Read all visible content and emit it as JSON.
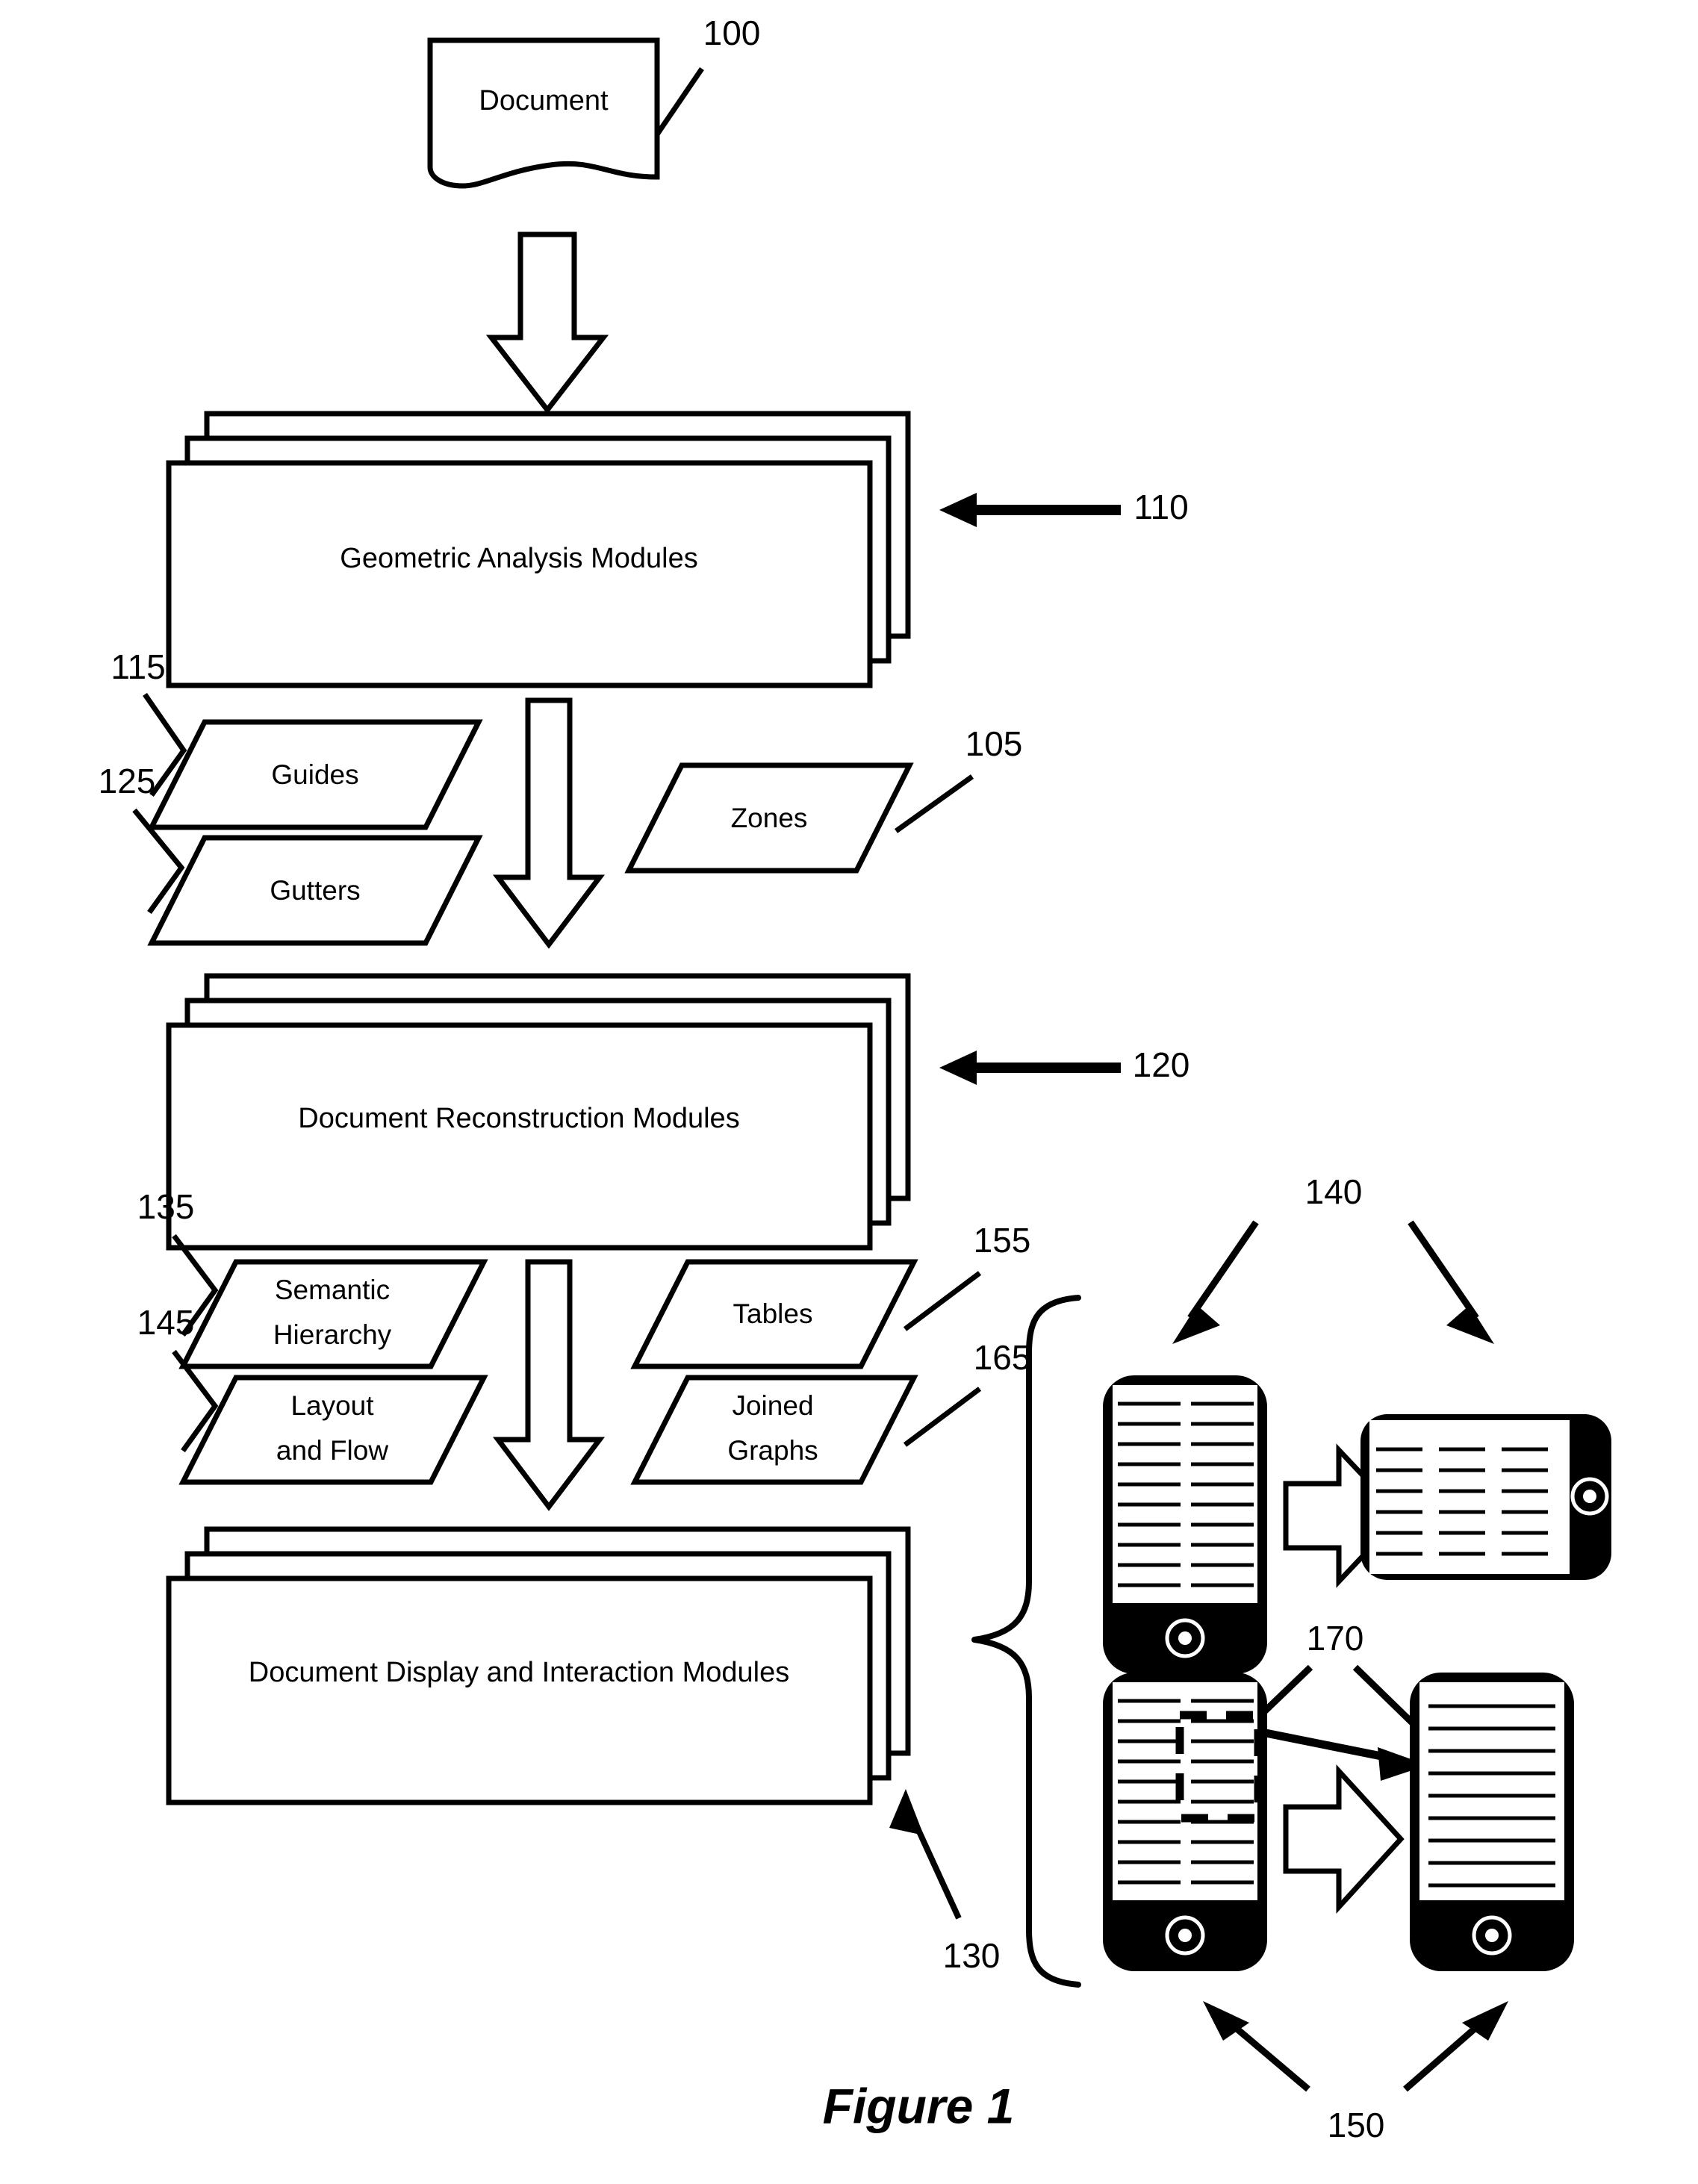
{
  "figure": {
    "caption": "Figure 1"
  },
  "nodes": {
    "document": {
      "label": "Document",
      "ref": "100"
    },
    "geometric_analysis": {
      "label": "Geometric Analysis Modules",
      "ref": "110"
    },
    "document_reconstruction": {
      "label": "Document Reconstruction Modules",
      "ref": "120"
    },
    "document_display": {
      "label": "Document Display and Interaction Modules",
      "ref": "130"
    }
  },
  "data_shapes": {
    "guides": {
      "label": "Guides",
      "ref": "115"
    },
    "gutters": {
      "label": "Gutters",
      "ref": "125"
    },
    "zones": {
      "label": "Zones",
      "ref": "105"
    },
    "semantic_hierarchy": {
      "label_line1": "Semantic",
      "label_line2": "Hierarchy",
      "ref": "135"
    },
    "layout_and_flow": {
      "label_line1": "Layout",
      "label_line2": "and Flow",
      "ref": "145"
    },
    "tables": {
      "label": "Tables",
      "ref": "155"
    },
    "joined_graphs": {
      "label_line1": "Joined",
      "label_line2": "Graphs",
      "ref": "165"
    }
  },
  "device_group": {
    "reflow_ref": "140",
    "interaction_ref": "150",
    "selection_ref": "170",
    "top_pair": {
      "source_device": "phone-portrait",
      "source_columns": 2,
      "source_lines_per_column": 10,
      "target_device": "tablet-landscape",
      "target_columns": 3,
      "target_lines_per_column": 7
    },
    "bottom_pair": {
      "source_device": "phone-portrait",
      "source_columns": 2,
      "source_lines_per_column": 10,
      "source_has_selection": true,
      "target_device": "phone-portrait",
      "target_columns": 1,
      "target_lines_per_column": 10
    }
  },
  "colors": {
    "ink": "#000000",
    "paper": "#ffffff"
  },
  "icons": {
    "home_button": "home-button-icon",
    "flow_arrow": "block-arrow-down-icon",
    "transform_arrow": "block-arrow-right-icon",
    "pointer_arrow": "solid-arrow-icon",
    "brace": "curly-brace-icon"
  }
}
